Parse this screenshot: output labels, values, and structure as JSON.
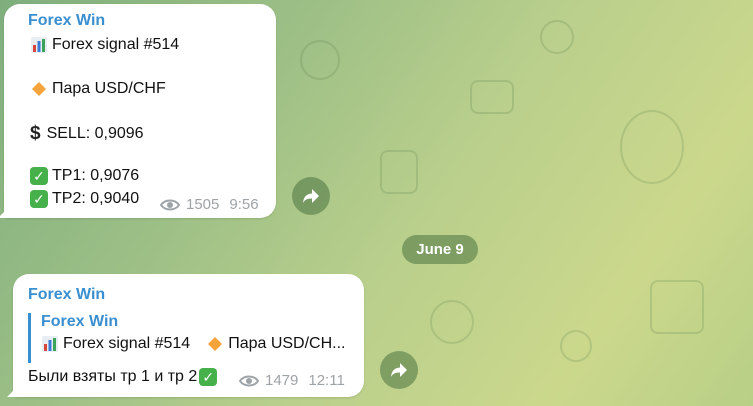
{
  "colors": {
    "accent": "#3a8fd0",
    "meta": "#9ea3a8",
    "check": "#46b04a",
    "pill": "#4a7240"
  },
  "message1": {
    "sender": "Forex Win",
    "signal": "Forex signal #514",
    "pair": "Пара USD/CHF",
    "sell": "SELL:  0,9096",
    "tp1": "TP1:  0,9076",
    "tp2": "TP2:  0,9040",
    "views": "1505",
    "time": "9:56",
    "icons": [
      "chart-icon",
      "orange-diamond-icon",
      "dollar-icon",
      "check-icon",
      "check-icon",
      "eye-icon",
      "forward-icon"
    ]
  },
  "date_separator": "June 9",
  "message2": {
    "sender": "Forex Win",
    "quote": {
      "sender": "Forex Win",
      "signal": "Forex signal #514",
      "pair": "Пара USD/CH..."
    },
    "text": "Были взяты тр 1 и тр 2",
    "views": "1479",
    "time": "12:11",
    "icons": [
      "chart-icon",
      "orange-diamond-icon",
      "check-icon",
      "eye-icon",
      "forward-icon"
    ]
  }
}
